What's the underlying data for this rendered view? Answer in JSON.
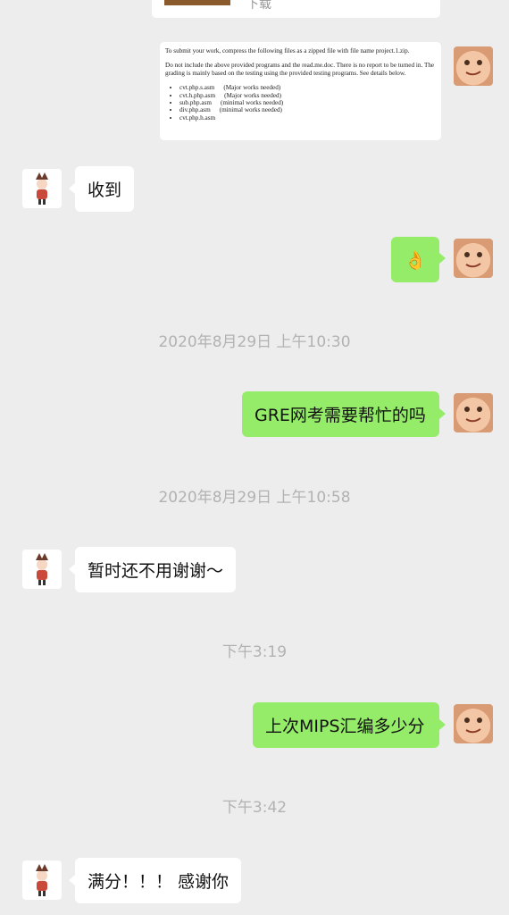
{
  "top_card": {
    "label": "下载"
  },
  "document": {
    "paragraph1": "To submit your work, compress the following files as a zipped file with file name project.1.zip.",
    "paragraph2": "Do not include the above provided programs and the read.me.doc. There is no report to be turned in. The grading is mainly based on the testing using the provided testing programs. See details below.",
    "files": [
      {
        "name": "cvt.php.s.asm",
        "note": "(Major works needed)"
      },
      {
        "name": "cvt.h.php.asm",
        "note": "(Major works needed)"
      },
      {
        "name": "sub.php.asm",
        "note": "(minimal works needed)"
      },
      {
        "name": "div.php.asm",
        "note": "(minimal works needed)"
      },
      {
        "name": "cvt.php.h.asm",
        "note": ""
      }
    ]
  },
  "messages": {
    "m1": "收到",
    "m2_emoji": "👌",
    "t1": "2020年8月29日 上午10:30",
    "m3": "GRE网考需要帮忙的吗",
    "t2": "2020年8月29日 上午10:58",
    "m4": "暂时还不用谢谢～",
    "t3": "下午3:19",
    "m5": "上次MIPS汇编多少分",
    "t4": "下午3:42",
    "m6": "满分！！！ 感谢你"
  },
  "avatars": {
    "self": "baby-avatar",
    "contact": "girl-avatar"
  },
  "colors": {
    "background": "#ededed",
    "outgoing_bubble": "#95ec69",
    "incoming_bubble": "#ffffff",
    "timestamp": "#b2b2b2"
  }
}
